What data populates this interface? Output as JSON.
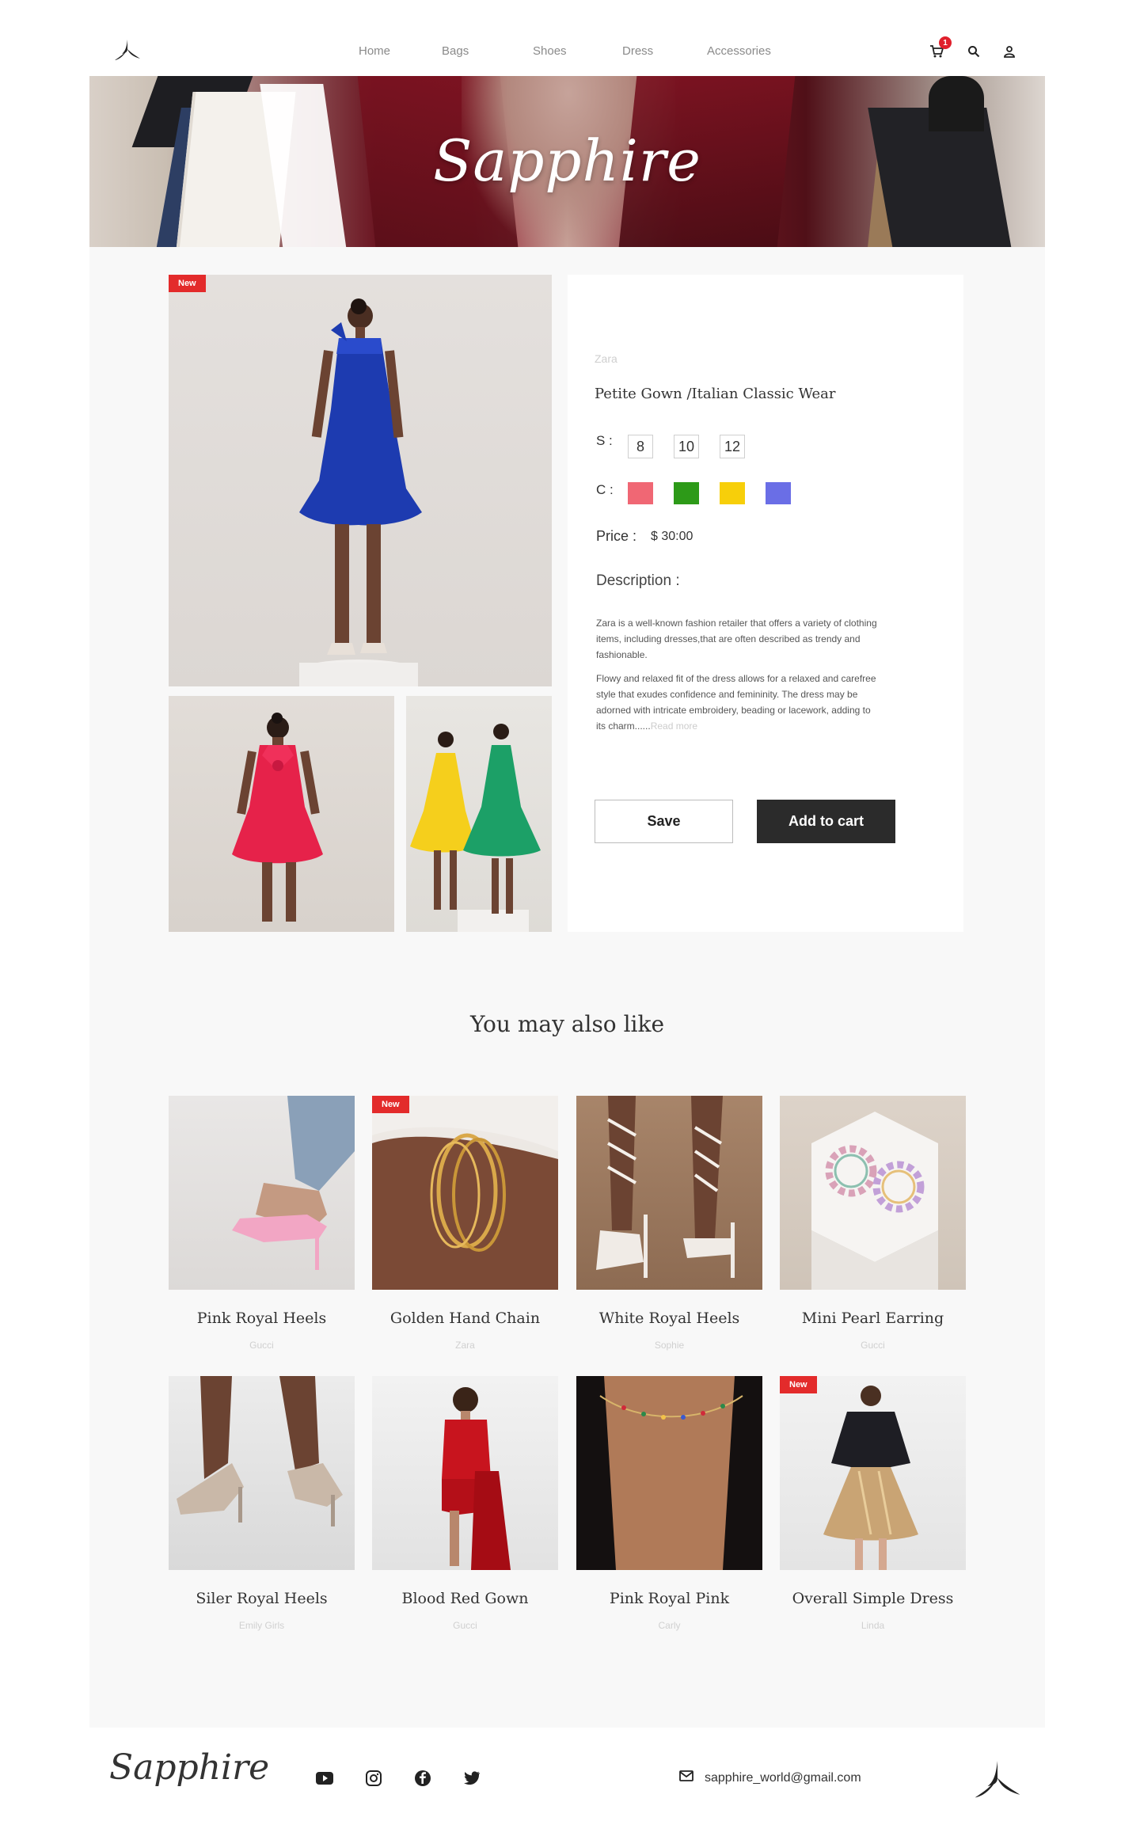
{
  "brand_name": "Sapphire",
  "nav": {
    "items": [
      "Home",
      "Bags",
      "Shoes",
      "Dress",
      "Accessories"
    ]
  },
  "header": {
    "cart_count": "1",
    "icons": [
      "cart-icon",
      "search-icon",
      "user-icon"
    ]
  },
  "hero": {
    "title": "Sapphire"
  },
  "product": {
    "badge": "New",
    "brand": "Zara",
    "name": "Petite Gown /Italian Classic Wear",
    "size_label": "S :",
    "sizes": [
      "8",
      "10",
      "12"
    ],
    "color_label": "C :",
    "colors": [
      "#f06774",
      "#2d9a18",
      "#f7cf0a",
      "#6a6ee6"
    ],
    "price_label": "Price :",
    "price_value": "$ 30:00",
    "description_label": "Description :",
    "description_p1": "Zara is a well-known fashion retailer that offers a variety of clothing items, including dresses,that are often described as trendy and fashionable.",
    "description_p2": "Flowy and relaxed fit of the dress allows for a relaxed and carefree style that exudes confidence and femininity. The dress may be adorned with intricate embroidery, beading or lacework, adding to its charm......",
    "read_more": "Read more",
    "save_label": "Save",
    "cart_label": "Add to cart"
  },
  "recommendations": {
    "title": "You may also like",
    "items": [
      {
        "name": "Pink Royal Heels",
        "brand": "Gucci",
        "badge": ""
      },
      {
        "name": "Golden Hand Chain",
        "brand": "Zara",
        "badge": "New"
      },
      {
        "name": "White Royal Heels",
        "brand": "Sophie",
        "badge": ""
      },
      {
        "name": "Mini Pearl Earring",
        "brand": "Gucci",
        "badge": ""
      },
      {
        "name": "Siler Royal Heels",
        "brand": "Emily Girls",
        "badge": ""
      },
      {
        "name": "Blood Red Gown",
        "brand": "Gucci",
        "badge": ""
      },
      {
        "name": "Pink Royal Pink",
        "brand": "Carly",
        "badge": ""
      },
      {
        "name": "Overall Simple Dress",
        "brand": "Linda",
        "badge": "New"
      }
    ]
  },
  "footer": {
    "logo": "Sapphire",
    "social": [
      "youtube-icon",
      "instagram-icon",
      "facebook-icon",
      "twitter-icon"
    ],
    "email": "sapphire_world@gmail.com"
  },
  "colors": {
    "accent_red": "#e32b2b",
    "dark_button": "#2b2b2b",
    "section_bg": "#f8f8f8"
  }
}
